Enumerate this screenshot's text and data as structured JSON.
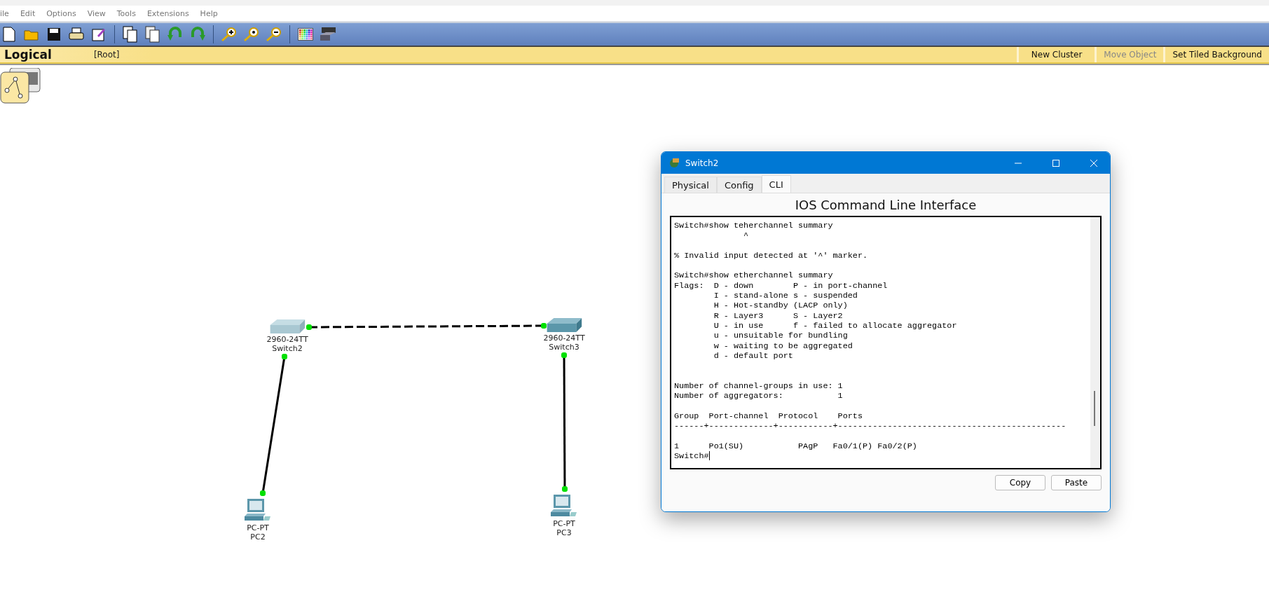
{
  "menu": [
    "ile",
    "Edit",
    "Options",
    "View",
    "Tools",
    "Extensions",
    "Help"
  ],
  "toolbar": [
    {
      "kind": "new"
    },
    {
      "kind": "open"
    },
    {
      "kind": "save"
    },
    {
      "kind": "print"
    },
    {
      "kind": "edit"
    },
    {
      "kind": "sep"
    },
    {
      "kind": "copy"
    },
    {
      "kind": "paste"
    },
    {
      "kind": "undo"
    },
    {
      "kind": "redo"
    },
    {
      "kind": "sep"
    },
    {
      "kind": "zoomin"
    },
    {
      "kind": "zoomreset"
    },
    {
      "kind": "zoomout"
    },
    {
      "kind": "sep"
    },
    {
      "kind": "palette"
    },
    {
      "kind": "device"
    }
  ],
  "workspace_bar": {
    "mode": "Logical",
    "path": "[Root]",
    "actions": [
      {
        "label": "New Cluster",
        "disabled": false
      },
      {
        "label": "Move Object",
        "disabled": true
      },
      {
        "label": "Set Tiled Background",
        "disabled": false
      }
    ]
  },
  "devices": [
    {
      "kind": "switch",
      "model": "2960-24TT",
      "name": "Switch2"
    },
    {
      "kind": "switch",
      "model": "2960-24TT",
      "name": "Switch3"
    },
    {
      "kind": "pc",
      "model": "PC-PT",
      "name": "PC2"
    },
    {
      "kind": "pc",
      "model": "PC-PT",
      "name": "PC3"
    }
  ],
  "links": [
    {
      "kind": "crossover"
    },
    {
      "kind": "straight"
    },
    {
      "kind": "straight"
    }
  ],
  "dialog": {
    "title": "Switch2",
    "tabs": [
      {
        "label": "Physical",
        "selected": false
      },
      {
        "label": "Config",
        "selected": false
      },
      {
        "label": "CLI",
        "selected": true
      }
    ],
    "heading": "IOS Command Line Interface",
    "cli_lines": [
      {
        "text": "Switch#show teherchannel summary",
        "kind": "line"
      },
      {
        "text": "              ^",
        "kind": "line"
      },
      {
        "text": "% Invalid input detected at '^' marker.",
        "kind": "spaced"
      },
      {
        "text": "Switch#show etherchannel summary",
        "kind": "spaced"
      },
      {
        "text": "Flags:  D - down        P - in port-channel",
        "kind": "line"
      },
      {
        "text": "        I - stand-alone s - suspended",
        "kind": "line"
      },
      {
        "text": "        H - Hot-standby (LACP only)",
        "kind": "line"
      },
      {
        "text": "        R - Layer3      S - Layer2",
        "kind": "line"
      },
      {
        "text": "        U - in use      f - failed to allocate aggregator",
        "kind": "line"
      },
      {
        "text": "        u - unsuitable for bundling",
        "kind": "line"
      },
      {
        "text": "        w - waiting to be aggregated",
        "kind": "line"
      },
      {
        "text": "        d - default port",
        "kind": "line"
      },
      {
        "text": "Number of channel-groups in use: 1",
        "kind": "wide_spaced"
      },
      {
        "text": "Number of aggregators:           1",
        "kind": "line"
      },
      {
        "text": "Group  Port-channel  Protocol    Ports",
        "kind": "spaced"
      },
      {
        "text": "------+-------------+-----------+----------------------------------------------",
        "kind": "line"
      },
      {
        "text": "1      Po1(SU)           PAgP   Fa0/1(P) Fa0/2(P)",
        "kind": "spaced"
      },
      {
        "text": "Switch#",
        "kind": "prompt"
      }
    ],
    "buttons": [
      "Copy",
      "Paste"
    ]
  }
}
